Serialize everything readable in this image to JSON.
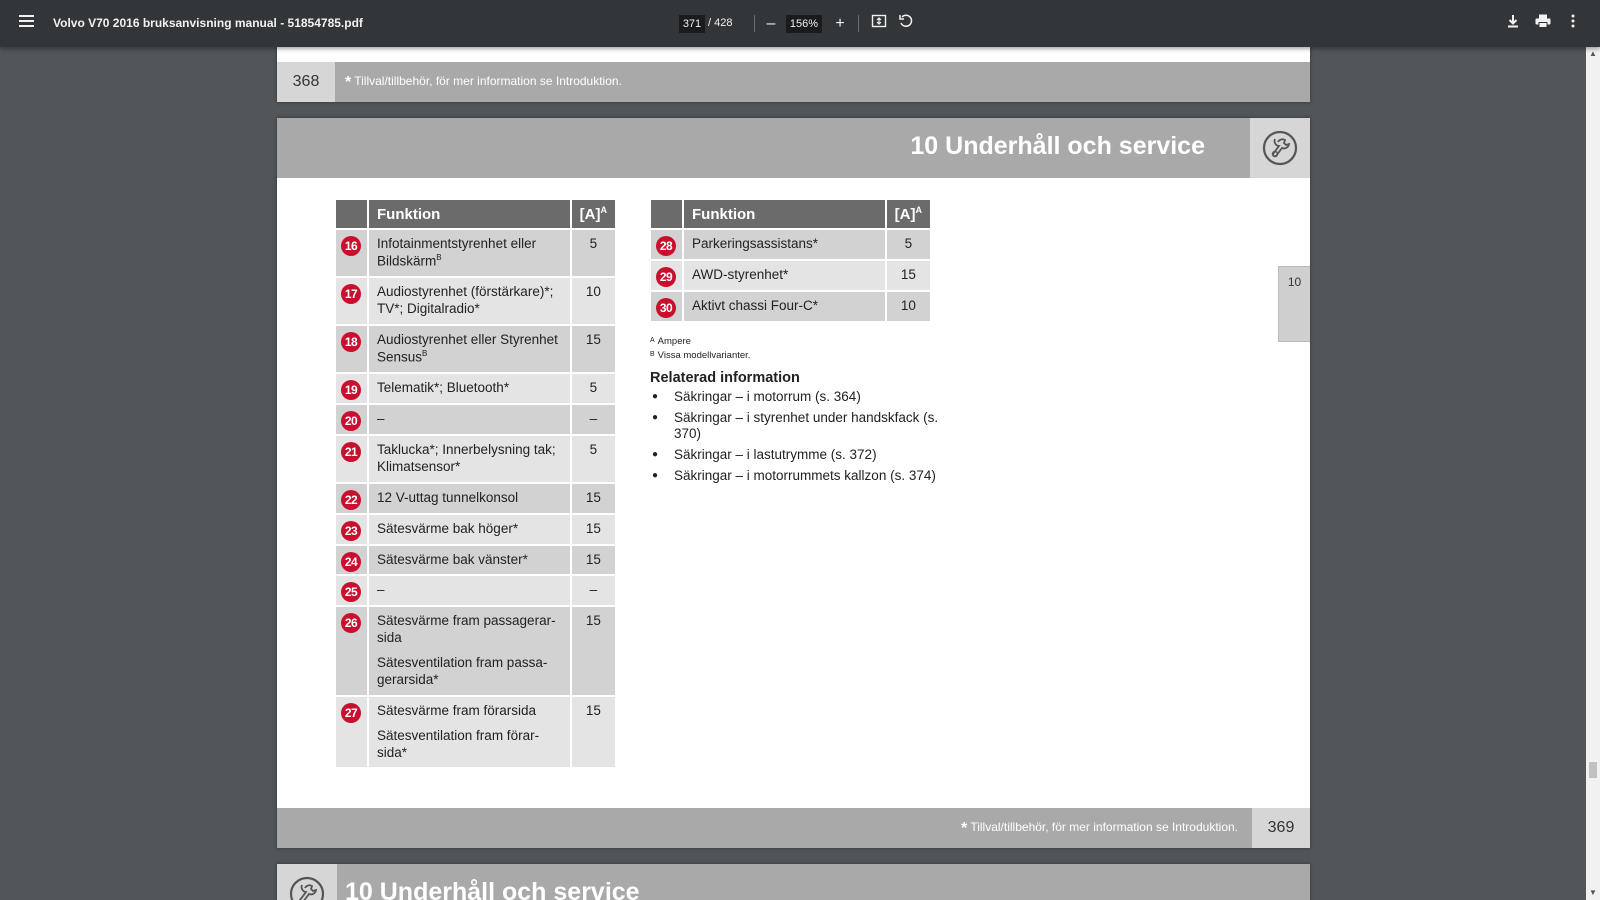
{
  "toolbar": {
    "title": "Volvo V70 2016 bruksanvisning manual - 51854785.pdf",
    "current_page": "371",
    "total_pages": "/ 428",
    "zoom": "156%",
    "zoom_out_symbol": "–",
    "zoom_in_symbol": "+",
    "icons": [
      "menu-icon",
      "zoom-out-icon",
      "zoom-in-icon",
      "fit-page-icon",
      "rotate-icon",
      "download-icon",
      "print-icon",
      "more-icon"
    ]
  },
  "prev_page": {
    "page_number": "368",
    "footnote_star": "*",
    "footnote": "Tillval/tillbehör, för mer information se Introduktion."
  },
  "page": {
    "section_title": "10 Underhåll och service",
    "side_tab": "10",
    "page_number": "369",
    "footnote_star": "*",
    "footnote": "Tillval/tillbehör, för mer information se Introduktion.",
    "table_header": {
      "function": "Funktion",
      "amp": "[A]",
      "amp_sup": "A"
    },
    "fuses_left": [
      {
        "num": "16",
        "text": "Infotainmentstyrenhet eller Bildskärm",
        "sup": "B",
        "sub": "",
        "amp": "5"
      },
      {
        "num": "17",
        "text": "Audiostyrenhet (förstärkare)*; TV*; Digitalradio*",
        "sup": "",
        "sub": "",
        "amp": "10"
      },
      {
        "num": "18",
        "text": "Audiostyrenhet eller Styrenhet Sensus",
        "sup": "B",
        "sub": "",
        "amp": "15"
      },
      {
        "num": "19",
        "text": "Telematik*; Bluetooth*",
        "sup": "",
        "sub": "",
        "amp": "5"
      },
      {
        "num": "20",
        "text": "–",
        "sup": "",
        "sub": "",
        "amp": "–"
      },
      {
        "num": "21",
        "text": "Taklucka*; Innerbelysning tak; Klimatsensor*",
        "sup": "",
        "sub": "",
        "amp": "5"
      },
      {
        "num": "22",
        "text": "12 V-uttag tunnelkonsol",
        "sup": "",
        "sub": "",
        "amp": "15"
      },
      {
        "num": "23",
        "text": "Sätesvärme bak höger*",
        "sup": "",
        "sub": "",
        "amp": "15"
      },
      {
        "num": "24",
        "text": "Sätesvärme bak vänster*",
        "sup": "",
        "sub": "",
        "amp": "15"
      },
      {
        "num": "25",
        "text": "–",
        "sup": "",
        "sub": "",
        "amp": "–"
      },
      {
        "num": "26",
        "text": "Sätesvärme fram passagerar-sida",
        "sup": "",
        "sub": "Sätesventilation fram passa-gerarsida*",
        "amp": "15"
      },
      {
        "num": "27",
        "text": "Sätesvärme fram förarsida",
        "sup": "",
        "sub": "Sätesventilation fram förar-sida*",
        "amp": "15"
      }
    ],
    "fuses_right": [
      {
        "num": "28",
        "text": "Parkeringsassistans*",
        "amp": "5"
      },
      {
        "num": "29",
        "text": "AWD-styrenhet*",
        "amp": "15"
      },
      {
        "num": "30",
        "text": "Aktivt chassi Four-C*",
        "amp": "10"
      }
    ],
    "footnotes": [
      {
        "mark": "A",
        "text": "Ampere"
      },
      {
        "mark": "B",
        "text": "Vissa modellvarianter."
      }
    ],
    "related": {
      "heading": "Relaterad information",
      "items": [
        "Säkringar – i motorrum (s. 364)",
        "Säkringar – i styrenhet under handskfack (s. 370)",
        "Säkringar – i lastutrymme (s. 372)",
        "Säkringar – i motorrummets kallzon (s. 374)"
      ]
    }
  },
  "next_page": {
    "section_title": "10 Underhåll och service"
  },
  "colors": {
    "toolbar_bg": "#323639",
    "viewer_bg": "#525659",
    "band_gray": "#a9a9a9",
    "fuse_red": "#c8102e"
  }
}
